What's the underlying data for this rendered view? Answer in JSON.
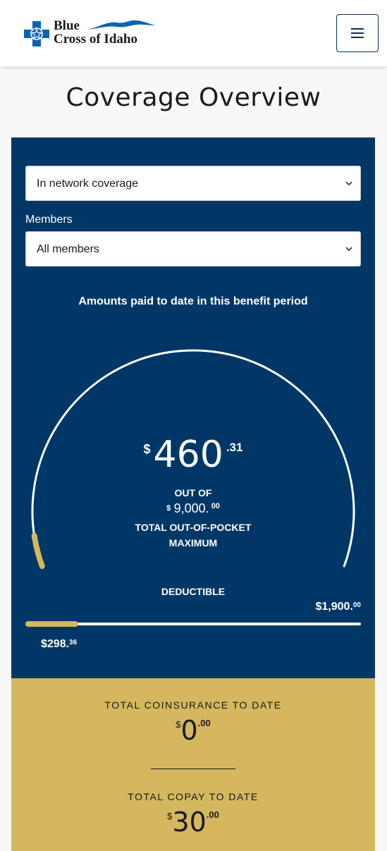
{
  "header": {
    "brand_line1": "Blue",
    "brand_line2": "Cross of Idaho",
    "colors": {
      "brand_blue": "#0a64b4",
      "navy": "#0a2f5e"
    }
  },
  "page_title": "Coverage Overview",
  "filters": {
    "coverage_select": "In network coverage",
    "members_label": "Members",
    "members_select": "All members"
  },
  "summary": {
    "heading": "Amounts paid to date in this benefit period",
    "oop_paid_currency": "$",
    "oop_paid_whole": "460",
    "oop_paid_cents": ".31",
    "out_of_label": "OUT OF",
    "oop_max_currency": "$",
    "oop_max_whole": "9,000.",
    "oop_max_cents": "00",
    "oop_max_label_line1": "TOTAL OUT-OF-POCKET",
    "oop_max_label_line2": "MAXIMUM",
    "oop_progress_fraction": 0.0511
  },
  "deductible": {
    "label": "DEDUCTIBLE",
    "max_whole": "$1,900.",
    "max_cents": "00",
    "paid_whole": "$298.",
    "paid_cents": "36",
    "progress_fraction": 0.157
  },
  "totals": {
    "coinsurance_label": "TOTAL COINSURANCE TO DATE",
    "coinsurance_currency": "$",
    "coinsurance_whole": "0",
    "coinsurance_cents": ".00",
    "copay_label": "TOTAL COPAY TO DATE",
    "copay_currency": "$",
    "copay_whole": "30",
    "copay_cents": ".00"
  },
  "colors": {
    "panel_navy": "#003767",
    "gold_accent": "#d4b75e"
  },
  "icons": {
    "logo": "blue-cross-logo-icon",
    "menu": "hamburger-menu-icon",
    "chevron": "chevron-down-icon"
  }
}
